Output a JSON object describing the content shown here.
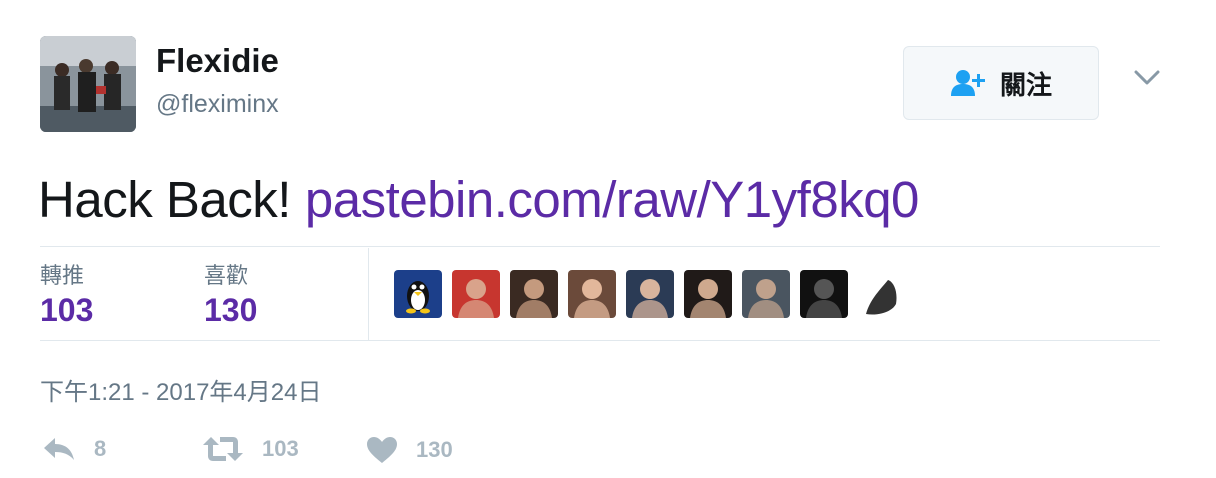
{
  "user": {
    "name": "Flexidie",
    "handle": "@fleximinx"
  },
  "follow_button": {
    "label": "關注"
  },
  "tweet": {
    "text": "Hack Back!",
    "link": "pastebin.com/raw/Y1yf8kq0"
  },
  "stats": {
    "retweets_label": "轉推",
    "retweets_count": "103",
    "likes_label": "喜歡",
    "likes_count": "130"
  },
  "likers": [
    {
      "name": "tux-penguin-avatar",
      "colors": [
        "#1c3f8a",
        "#f5c518"
      ]
    },
    {
      "name": "red-sunglasses-avatar",
      "colors": [
        "#c7362f",
        "#d9a38b"
      ]
    },
    {
      "name": "curly-hair-avatar",
      "colors": [
        "#3a2a22",
        "#c49a7e"
      ]
    },
    {
      "name": "smiling-man-avatar",
      "colors": [
        "#6b4a3a",
        "#e2b79b"
      ]
    },
    {
      "name": "young-man-avatar",
      "colors": [
        "#2b3b55",
        "#d8b49d"
      ]
    },
    {
      "name": "dark-hair-avatar",
      "colors": [
        "#201a18",
        "#cfa98e"
      ]
    },
    {
      "name": "older-man-avatar",
      "colors": [
        "#4a5560",
        "#bfa18c"
      ]
    },
    {
      "name": "dark-photo-avatar",
      "colors": [
        "#111111",
        "#555555"
      ]
    },
    {
      "name": "grayscale-avatar",
      "colors": [
        "#ffffff",
        "#333333"
      ]
    }
  ],
  "timestamp": "下午1:21 - 2017年4月24日",
  "actions": {
    "reply_count": "8",
    "retweet_count": "103",
    "like_count": "130"
  },
  "colors": {
    "link": "#5b2ba6",
    "follow_icon": "#1da1f2",
    "muted": "#aab8c2"
  }
}
